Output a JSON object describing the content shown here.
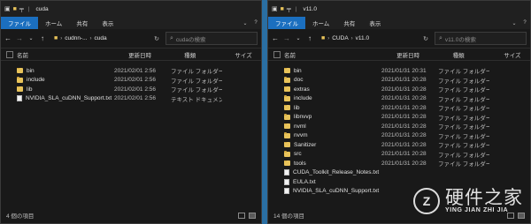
{
  "ribbon": {
    "file": "ファイル",
    "home": "ホーム",
    "share": "共有",
    "view": "表示"
  },
  "columns": {
    "name": "名前",
    "date": "更新日時",
    "type": "種類",
    "size": "サイズ"
  },
  "left": {
    "title": "cuda",
    "breadcrumbs": [
      "cudnn-...",
      "cuda"
    ],
    "search_placeholder": "cudaの検索",
    "items": [
      {
        "name": "bin",
        "date": "2021/02/01 2:56",
        "type": "ファイル フォルダー",
        "icon": "folder-icon"
      },
      {
        "name": "include",
        "date": "2021/02/01 2:56",
        "type": "ファイル フォルダー",
        "icon": "folder-icon"
      },
      {
        "name": "lib",
        "date": "2021/02/01 2:56",
        "type": "ファイル フォルダー",
        "icon": "folder-icon"
      },
      {
        "name": "NVIDIA_SLA_cuDNN_Support.txt",
        "date": "2021/02/01 2:56",
        "type": "テキスト ドキュメント",
        "icon": "file-icon"
      }
    ],
    "status": "4 個の項目"
  },
  "right": {
    "title": "v11.0",
    "breadcrumbs": [
      "CUDA",
      "v11.0"
    ],
    "search_placeholder": "v11.0の検索",
    "items": [
      {
        "name": "bin",
        "date": "2021/01/31 20:31",
        "type": "ファイル フォルダー",
        "icon": "folder-icon"
      },
      {
        "name": "doc",
        "date": "2021/01/31 20:28",
        "type": "ファイル フォルダー",
        "icon": "folder-icon"
      },
      {
        "name": "extras",
        "date": "2021/01/31 20:28",
        "type": "ファイル フォルダー",
        "icon": "folder-icon"
      },
      {
        "name": "include",
        "date": "2021/01/31 20:28",
        "type": "ファイル フォルダー",
        "icon": "folder-icon"
      },
      {
        "name": "lib",
        "date": "2021/01/31 20:28",
        "type": "ファイル フォルダー",
        "icon": "folder-icon"
      },
      {
        "name": "libnvvp",
        "date": "2021/01/31 20:28",
        "type": "ファイル フォルダー",
        "icon": "folder-icon"
      },
      {
        "name": "nvml",
        "date": "2021/01/31 20:28",
        "type": "ファイル フォルダー",
        "icon": "folder-icon"
      },
      {
        "name": "nvvm",
        "date": "2021/01/31 20:28",
        "type": "ファイル フォルダー",
        "icon": "folder-icon"
      },
      {
        "name": "Sanitizer",
        "date": "2021/01/31 20:28",
        "type": "ファイル フォルダー",
        "icon": "folder-icon"
      },
      {
        "name": "src",
        "date": "2021/01/31 20:28",
        "type": "ファイル フォルダー",
        "icon": "folder-icon"
      },
      {
        "name": "tools",
        "date": "2021/01/31 20:28",
        "type": "ファイル フォルダー",
        "icon": "folder-icon"
      },
      {
        "name": "CUDA_Toolkit_Release_Notes.txt",
        "date": "",
        "type": "",
        "icon": "file-icon"
      },
      {
        "name": "EULA.txt",
        "date": "",
        "type": "",
        "icon": "file-icon"
      },
      {
        "name": "NVIDIA_SLA_cuDNN_Support.txt",
        "date": "",
        "type": "",
        "icon": "file-icon"
      }
    ],
    "status": "14 個の項目"
  },
  "watermark": {
    "logo": "Z",
    "main": "硬件之家",
    "sub": "YING JIAN ZHI JIA"
  },
  "colors": {
    "accent": "#1b6fbf",
    "folder": "#e8c35a",
    "window_bg": "#191919",
    "desktop": "#2a6fa3"
  }
}
